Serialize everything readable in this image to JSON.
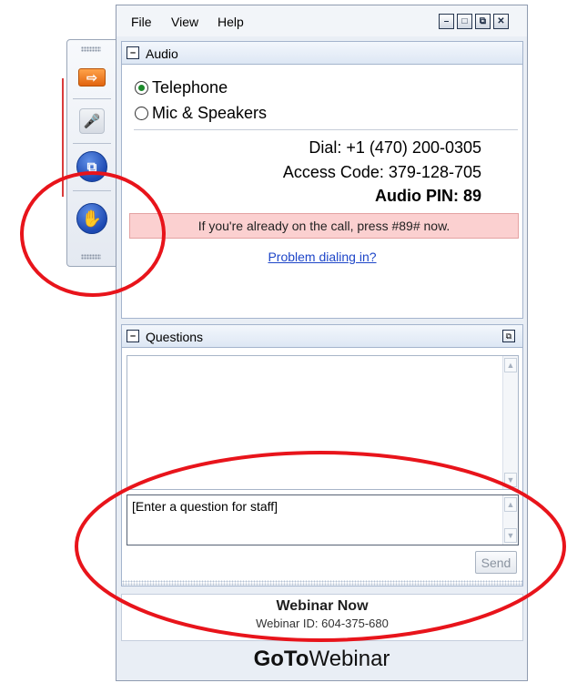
{
  "menu": {
    "file": "File",
    "view": "View",
    "help": "Help"
  },
  "window_controls": {
    "minimize": "–",
    "restore": "□",
    "popout": "⧉",
    "close": "✕"
  },
  "left_tab": {
    "buttons": [
      {
        "icon": "orange-arrow-icon",
        "glyph": "⇨"
      },
      {
        "icon": "microphone-icon",
        "glyph": "🎤"
      },
      {
        "icon": "screen-share-icon",
        "glyph": "⧉"
      },
      {
        "icon": "raise-hand-icon",
        "glyph": "✋"
      }
    ]
  },
  "audio": {
    "title": "Audio",
    "collapse": "–",
    "options": [
      "Telephone",
      "Mic & Speakers"
    ],
    "selected": "Telephone",
    "dial": "Dial: +1 (470) 200-0305",
    "access_code": "Access Code: 379-128-705",
    "audio_pin": "Audio PIN: 89",
    "alert": "If you're already on the call, press #89# now.",
    "help_link": "Problem dialing in?"
  },
  "questions": {
    "title": "Questions",
    "collapse": "–",
    "popout": "⧉",
    "input_placeholder": "[Enter a question for staff]",
    "send": "Send",
    "scroll_up": "▲",
    "scroll_down": "▼"
  },
  "footer": {
    "webinar_title": "Webinar Now",
    "webinar_id": "Webinar ID: 604-375-680",
    "brand_bold": "GoTo",
    "brand_regular": "Webinar"
  },
  "colors": {
    "annotation_red": "#e8141b",
    "alert_bg": "#fbd0d0",
    "link": "#1e46c8"
  }
}
